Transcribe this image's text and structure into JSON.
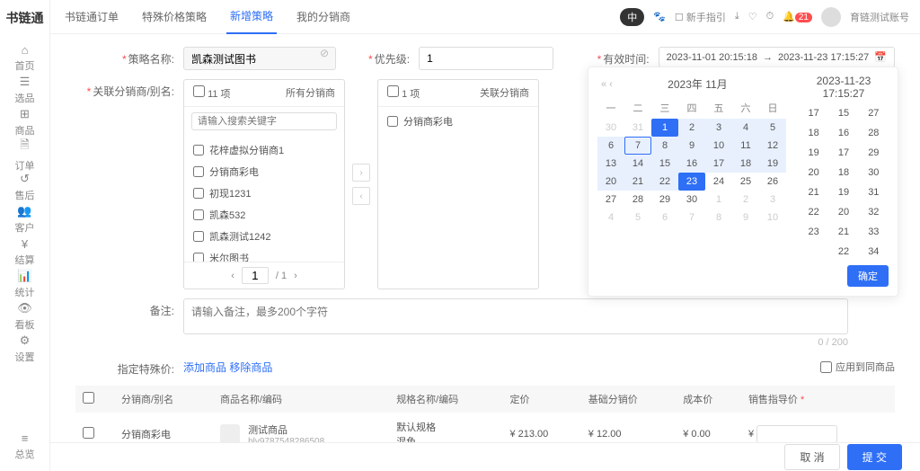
{
  "app": {
    "logo": "书链通"
  },
  "sidebar": {
    "items": [
      {
        "icon": "⌂",
        "label": "首页"
      },
      {
        "icon": "☰",
        "label": "选品"
      },
      {
        "icon": "⊞",
        "label": "商品"
      },
      {
        "icon": "🗎",
        "label": "订单"
      },
      {
        "icon": "↺",
        "label": "售后"
      },
      {
        "icon": "👥",
        "label": "客户"
      },
      {
        "icon": "¥",
        "label": "结算"
      },
      {
        "icon": "📊",
        "label": "统计"
      },
      {
        "icon": "👁",
        "label": "看板"
      },
      {
        "icon": "⚙",
        "label": "设置"
      }
    ],
    "bottom": {
      "icon": "≡",
      "label": "总览"
    }
  },
  "top": {
    "tabs": [
      "书链通订单",
      "特殊价格策略",
      "新增策略",
      "我的分销商"
    ],
    "active": 2,
    "lang": "中",
    "guide": "新手指引",
    "badge": "21",
    "user": "育链测试账号"
  },
  "form": {
    "name_label": "策略名称:",
    "name_value": "凯森测试图书",
    "priority_label": "优先级:",
    "priority_value": "1",
    "date_label": "有效时间:",
    "date_start": "2023-11-01 20:15:18",
    "date_end": "2023-11-23 17:15:27",
    "assoc_label": "关联分销商/别名:",
    "remark_label": "备注:",
    "remark_ph": "请输入备注，最多200个字符",
    "char_count": "0 / 200",
    "special_label": "指定特殊价:",
    "add_goods": "添加商品",
    "remove_goods": "移除商品",
    "apply_same": "应用到同商品"
  },
  "transfer": {
    "left_count": "11 项",
    "left_title": "所有分销商",
    "right_count": "1 项",
    "right_title": "关联分销商",
    "search_ph": "请输入搜索关键字",
    "left_items": [
      "花梓虚拟分销商1",
      "分销商彩电",
      "初现1231",
      "凯森532",
      "凯森测试1242",
      "米尔图书"
    ],
    "right_items": [
      "分销商彩电"
    ],
    "page_cur": "1",
    "page_total": "/  1"
  },
  "calendar": {
    "left_title": "2023年 11月",
    "right_title": "2023-11-23 17:15:27",
    "weekdays": [
      "一",
      "二",
      "三",
      "四",
      "五",
      "六",
      "日"
    ],
    "confirm": "确定"
  },
  "table": {
    "cols": [
      "",
      "分销商/别名",
      "商品名称/编码",
      "规格名称/编码",
      "定价",
      "基础分销价",
      "成本价",
      "销售指导价"
    ],
    "row": {
      "dist": "分销商彩电",
      "sku_name": "测试商品",
      "sku_code": "blv9787548286508",
      "spec1": "默认规格",
      "spec2": "混色",
      "price": "¥ 213.00",
      "base": "¥ 12.00",
      "cost": "¥ 0.00",
      "guide_prefix": "¥"
    }
  },
  "footer": {
    "cancel": "取 消",
    "submit": "提 交"
  }
}
